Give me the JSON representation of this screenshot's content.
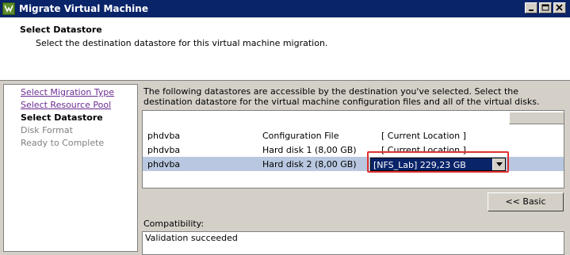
{
  "window": {
    "title": "Migrate Virtual Machine",
    "controls": [
      "minimize-icon",
      "maximize-icon",
      "close-icon"
    ]
  },
  "header": {
    "title": "Select Datastore",
    "subtitle": "Select the destination datastore for this virtual machine migration."
  },
  "sidebar": {
    "items": [
      {
        "label": "Select Migration Type",
        "state": "link"
      },
      {
        "label": "Select Resource Pool",
        "state": "link"
      },
      {
        "label": "Select Datastore",
        "state": "current"
      },
      {
        "label": "Disk Format",
        "state": "disabled"
      },
      {
        "label": "Ready to Complete",
        "state": "disabled"
      }
    ]
  },
  "main": {
    "description": "The following datastores are accessible by the destination you've selected. Select the destination datastore for the virtual machine configuration files and all of the virtual disks.",
    "rows": [
      {
        "vm": "phdvba",
        "item": "Configuration File",
        "datastore": "[ Current Location ]"
      },
      {
        "vm": "phdvba",
        "item": "Hard disk 1 (8,00 GB)",
        "datastore": "[ Current Location ]"
      },
      {
        "vm": "phdvba",
        "item": "Hard disk 2 (8,00 GB)",
        "datastore": "[NFS_Lab] 229,23 GB",
        "selected": true
      }
    ],
    "basic_button": "<< Basic",
    "compatibility_label": "Compatibility:",
    "compatibility_value": "Validation succeeded"
  },
  "colors": {
    "titlebar": "#0a246a",
    "selected_row": "#b9c8e0",
    "highlight_box": "#e03030",
    "link": "#6b2c91"
  }
}
